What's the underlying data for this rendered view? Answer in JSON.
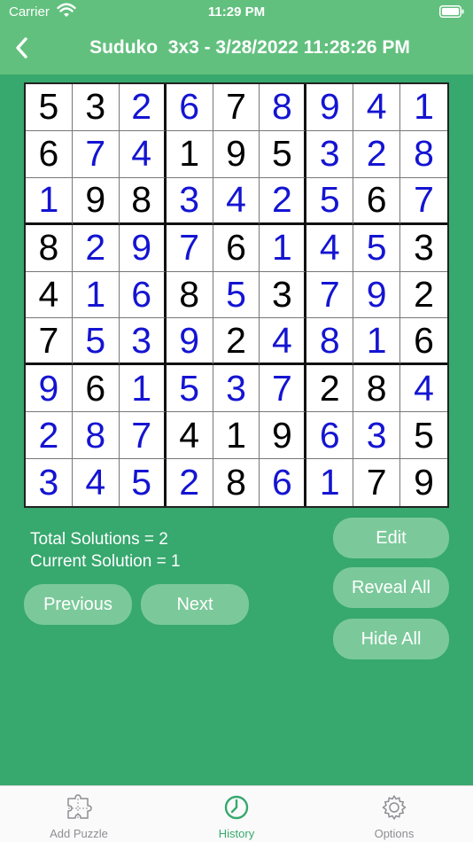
{
  "status_bar": {
    "carrier": "Carrier",
    "time": "11:29 PM"
  },
  "nav": {
    "title": "Suduko  3x3 - 3/28/2022 11:28:26 PM",
    "back_icon": "chevron-left-icon"
  },
  "board": {
    "digits": [
      [
        5,
        3,
        2,
        6,
        7,
        8,
        9,
        4,
        1
      ],
      [
        6,
        7,
        4,
        1,
        9,
        5,
        3,
        2,
        8
      ],
      [
        1,
        9,
        8,
        3,
        4,
        2,
        5,
        6,
        7
      ],
      [
        8,
        2,
        9,
        7,
        6,
        1,
        4,
        5,
        3
      ],
      [
        4,
        1,
        6,
        8,
        5,
        3,
        7,
        9,
        2
      ],
      [
        7,
        5,
        3,
        9,
        2,
        4,
        8,
        1,
        6
      ],
      [
        9,
        6,
        1,
        5,
        3,
        7,
        2,
        8,
        4
      ],
      [
        2,
        8,
        7,
        4,
        1,
        9,
        6,
        3,
        5
      ],
      [
        3,
        4,
        5,
        2,
        8,
        6,
        1,
        7,
        9
      ]
    ],
    "given": [
      [
        1,
        1,
        0,
        0,
        1,
        0,
        0,
        0,
        0
      ],
      [
        1,
        0,
        0,
        1,
        1,
        1,
        0,
        0,
        0
      ],
      [
        0,
        1,
        1,
        0,
        0,
        0,
        0,
        1,
        0
      ],
      [
        1,
        0,
        0,
        0,
        1,
        0,
        0,
        0,
        1
      ],
      [
        1,
        0,
        0,
        1,
        0,
        1,
        0,
        0,
        1
      ],
      [
        1,
        0,
        0,
        0,
        1,
        0,
        0,
        0,
        1
      ],
      [
        0,
        1,
        0,
        0,
        0,
        0,
        1,
        1,
        0
      ],
      [
        0,
        0,
        0,
        1,
        1,
        1,
        0,
        0,
        1
      ],
      [
        0,
        0,
        0,
        0,
        1,
        0,
        0,
        1,
        1
      ]
    ],
    "given_color": "#000000",
    "solved_color": "#1414d2"
  },
  "info": {
    "total_solutions": "Total Solutions = 2",
    "current_solution": "Current Solution = 1"
  },
  "buttons": {
    "edit": "Edit",
    "reveal_all": "Reveal All",
    "hide_all": "Hide All",
    "previous": "Previous",
    "next": "Next"
  },
  "tabs": [
    {
      "label": "Add Puzzle",
      "icon": "puzzle-icon",
      "active": false
    },
    {
      "label": "History",
      "icon": "clock-icon",
      "active": true
    },
    {
      "label": "Options",
      "icon": "gear-icon",
      "active": false
    }
  ],
  "colors": {
    "background": "#37a86e",
    "header": "#62c07e",
    "button": "#7bc99a",
    "tab_active": "#37a86e"
  }
}
